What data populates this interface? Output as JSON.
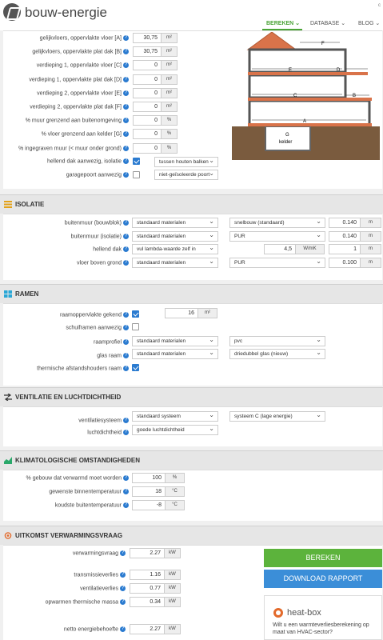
{
  "header": {
    "brand": "bouw-energie",
    "corner": "c",
    "nav": [
      "BEREKEN ⌄",
      "DATABASE ⌄",
      "BLOG ⌄"
    ]
  },
  "geometry": {
    "rows": [
      {
        "label": "gelijkvloers, oppervlakte vloer [A]",
        "value": "30,75",
        "unit": "m²"
      },
      {
        "label": "gelijkvloers, oppervlakte plat dak [B]",
        "value": "30,75",
        "unit": "m²"
      },
      {
        "label": "verdieping 1, oppervlakte vloer [C]",
        "value": "0",
        "unit": "m²"
      },
      {
        "label": "verdieping 1, oppervlakte plat dak [D]",
        "value": "0",
        "unit": "m²"
      },
      {
        "label": "verdieping 2, oppervlakte vloer [E]",
        "value": "0",
        "unit": "m²"
      },
      {
        "label": "verdieping 2, oppervlakte plat dak [F]",
        "value": "0",
        "unit": "m²"
      },
      {
        "label": "% muur grenzend aan buitenomgeving",
        "value": "0",
        "unit": "%"
      },
      {
        "label": "% vloer grenzend aan kelder [G]",
        "value": "0",
        "unit": "%"
      },
      {
        "label": "% ingegraven muur (< muur onder grond)",
        "value": "0",
        "unit": "%"
      }
    ],
    "roof_label": "hellend dak aanwezig, isolatie",
    "roof_select": "tussen houten balken",
    "garage_label": "garagepoort aanwezig",
    "garage_select": "niet-geïsoleerde poort",
    "diagram_labels": {
      "a": "A",
      "b": "B",
      "c": "C",
      "d": "D",
      "e": "E",
      "f": "F",
      "g": "G",
      "kelder": "kelder"
    }
  },
  "isolatie": {
    "title": "ISOLATIE",
    "rows": [
      {
        "label": "buitenmuur (bouwblok)",
        "sel1": "standaard materialen",
        "sel2": "snelbouw (standaard)",
        "value": "0.140",
        "unit": "m"
      },
      {
        "label": "buitenmuur (isolatie)",
        "sel1": "standaard materialen",
        "sel2": "PUR",
        "value": "0.140",
        "unit": "m"
      },
      {
        "label": "hellend dak",
        "sel1": "vul lambda-waarde zelf in",
        "lambda": "4,5",
        "lambda_unit": "W/mK",
        "value": "1",
        "unit": "m"
      },
      {
        "label": "vloer boven grond",
        "sel1": "standaard materialen",
        "sel2": "PUR",
        "value": "0.100",
        "unit": "m"
      }
    ]
  },
  "ramen": {
    "title": "RAMEN",
    "area_label": "raamoppervlakte gekend",
    "area_value": "16",
    "area_unit": "m²",
    "schuif_label": "schuiframen aanwezig",
    "profiel_label": "raamprofiel",
    "profiel_sel1": "standaard materialen",
    "profiel_sel2": "pvc",
    "glas_label": "glas raam",
    "glas_sel1": "standaard materialen",
    "glas_sel2": "driedubbel glas (nieuw)",
    "therm_label": "thermische afstandshouders raam"
  },
  "ventilatie": {
    "title": "VENTILATIE EN LUCHTDICHTHEID",
    "sys_label": "ventilatiesysteem",
    "sys_sel1": "standaard systeem",
    "sys_sel2": "systeem C (lage energie)",
    "lucht_label": "luchtdichtheid",
    "lucht_sel": "goede luchtdichtheid"
  },
  "klimaat": {
    "title": "KLIMATOLOGISCHE OMSTANDIGHEDEN",
    "rows": [
      {
        "label": "% gebouw dat verwarmd moet worden",
        "value": "100",
        "unit": "%"
      },
      {
        "label": "gewenste binnentemperatuur",
        "value": "18",
        "unit": "°C"
      },
      {
        "label": "koudste buitentemperatuur",
        "value": "-8",
        "unit": "°C"
      }
    ]
  },
  "uitkomst": {
    "title": "UITKOMST VERWARMINGSVRAAG",
    "rows": [
      {
        "label": "verwarmingsvraag",
        "value": "2.27",
        "unit": "kW"
      },
      {
        "label": "transmissieverlies",
        "value": "1.16",
        "unit": "kW"
      },
      {
        "label": "ventilatieverlies",
        "value": "0.77",
        "unit": "kW"
      },
      {
        "label": "opwarmen thermische massa",
        "value": "0.34",
        "unit": "kW"
      },
      {
        "label": "netto energiebehoefte",
        "value": "2.27",
        "unit": "kW"
      }
    ],
    "bereken": "BEREKEN",
    "download": "DOWNLOAD RAPPORT",
    "heatbox_name": "heat-box",
    "heatbox_text": "Wilt u een warmteverliesberekening op maat van HVAC-sector?"
  },
  "colors": {
    "green": "#5cb33c",
    "blue": "#3b8ed8",
    "accent_blue": "#2b7bd0"
  }
}
